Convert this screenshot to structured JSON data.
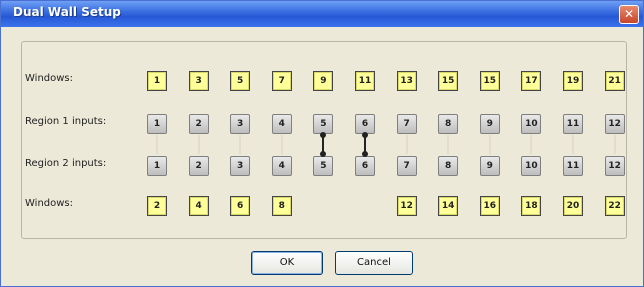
{
  "dialog": {
    "title": "Dual Wall Setup",
    "close_glyph": "✕"
  },
  "rows": {
    "top_windows_label": "Windows:",
    "region1_label": "Region 1 inputs:",
    "region2_label": "Region 2 inputs:",
    "bottom_windows_label": "Windows:"
  },
  "top_windows": [
    "1",
    "3",
    "5",
    "7",
    "9",
    "11",
    "13",
    "15",
    "15",
    "17",
    "19",
    "21"
  ],
  "region1_inputs": [
    "1",
    "2",
    "3",
    "4",
    "5",
    "6",
    "7",
    "8",
    "9",
    "10",
    "11",
    "12"
  ],
  "region2_inputs": [
    "1",
    "2",
    "3",
    "4",
    "5",
    "6",
    "7",
    "8",
    "9",
    "10",
    "11",
    "12"
  ],
  "bottom_windows": [
    "2",
    "4",
    "6",
    "8",
    "",
    "",
    "12",
    "14",
    "16",
    "18",
    "20",
    "22"
  ],
  "links": [
    false,
    false,
    false,
    false,
    true,
    true,
    false,
    false,
    false,
    false,
    false,
    false
  ],
  "buttons": {
    "ok": "OK",
    "cancel": "Cancel"
  },
  "colors": {
    "title_bar": "#2658d6",
    "window_cell": "#ffff99",
    "dialog_bg": "#ece9d8"
  }
}
